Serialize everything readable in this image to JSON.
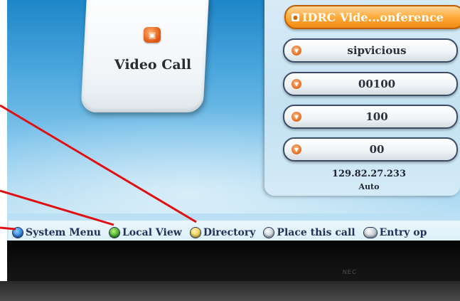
{
  "video_call_tile": {
    "icon": "video-call-icon",
    "label": "Video Call"
  },
  "call_list": [
    {
      "label": "IDRC Vide...onference",
      "icon": "conference-icon",
      "selected": true
    },
    {
      "label": "sipvicious",
      "icon": "contact-icon",
      "selected": false
    },
    {
      "label": "00100",
      "icon": "contact-icon",
      "selected": false
    },
    {
      "label": "100",
      "icon": "contact-icon",
      "selected": false
    },
    {
      "label": "00",
      "icon": "contact-icon",
      "selected": false
    }
  ],
  "status": {
    "ip_address": "129.82.27.233",
    "mode": "Auto"
  },
  "hint_bar": [
    {
      "key": "blue",
      "label": "System Menu"
    },
    {
      "key": "green",
      "label": "Local View"
    },
    {
      "key": "yellow",
      "label": "Directory"
    },
    {
      "key": "white",
      "label": "Place this call"
    },
    {
      "key": "grey",
      "label": "Entry op"
    }
  ],
  "bezel": {
    "brand": "NEC"
  },
  "colors": {
    "screen_blue": "#1e86c8",
    "selected_orange": "#f08a12",
    "annotation_red": "#e01010"
  }
}
